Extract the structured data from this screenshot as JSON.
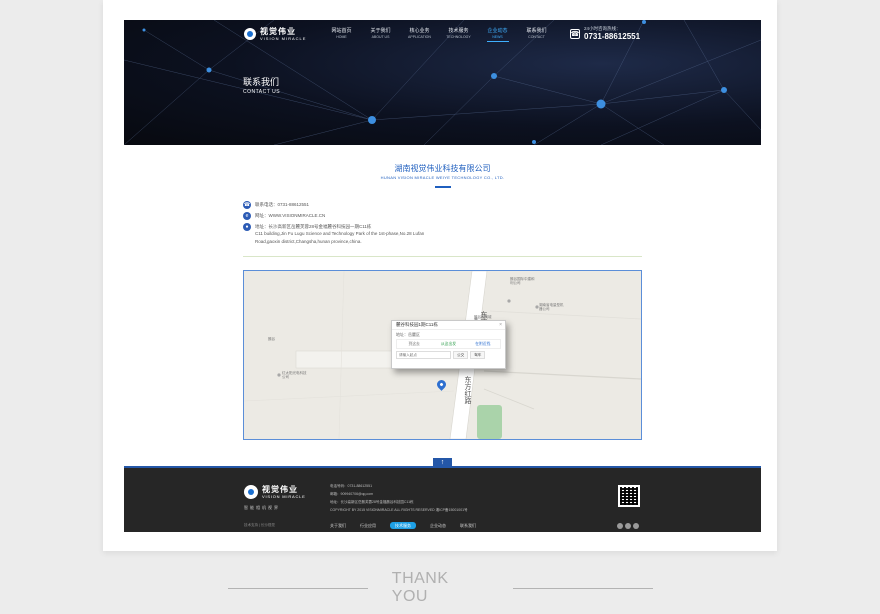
{
  "header": {
    "logo_cn": "视觉伟业",
    "logo_en": "VISION MIRACLE",
    "nav": [
      {
        "cn": "网站首页",
        "en": "HOME"
      },
      {
        "cn": "关于我们",
        "en": "ABOUT US"
      },
      {
        "cn": "核心业务",
        "en": "APPLICATION"
      },
      {
        "cn": "技术服务",
        "en": "TECHNOLOGY"
      },
      {
        "cn": "企业动态",
        "en": "NEWS"
      },
      {
        "cn": "联系我们",
        "en": "CONTACT"
      }
    ],
    "active_nav_index": 4,
    "hotline_label": "24小时咨询热线：",
    "hotline_number": "0731-88612551"
  },
  "hero": {
    "title_cn": "联系我们",
    "title_en": "CONTACT US"
  },
  "company": {
    "name_cn": "湖南视觉伟业科技有限公司",
    "name_en": "HUNAN VISION MIRACLE WEIYE TECHNOLOGY CO., LTD."
  },
  "contacts": {
    "phone": "联系电话：0731-88612551",
    "website": "网址：WWW.VISIONMIRACLE.CN",
    "address_cn": "地址：长沙高新区岳麓芙蓉28号金福麓谷科技园一期C11栋",
    "address_en_1": "C11 building,Jin Fu Lugu Science and Technology Park of the 1st-phase,No.28 Lufan",
    "address_en_2": "Road,gaoxin district,Changsha,hunan province,china."
  },
  "map": {
    "popup_title": "麓谷科技园1期C11栋",
    "popup_address": "地址：岳麓区",
    "tab_1": "到这去",
    "tab_2": "从这出发",
    "tab_3": "在附近找",
    "search_placeholder": "请输入起点",
    "btn_bus": "公交",
    "btn_drive": "驾车",
    "road_label": "东方红路",
    "place_1": "麓谷国际中建和利公司",
    "place_2": "湖南省电量型机器公司",
    "place_3": "麓谷家具城",
    "place_4": "红太阳光电科技公司",
    "place_5": "麓谷"
  },
  "back_top": {
    "label": "返回顶部"
  },
  "footer": {
    "logo_cn": "视觉伟业",
    "logo_en": "VISION MIRACLE",
    "slogan": "智能相机视界",
    "info_1": "电话号码：0731-88612551",
    "info_2": "邮箱：909940706@qq.com",
    "info_3": "地址：长沙高新区岳麓芙蓉28号金福麓谷科技园C11栋",
    "info_4": "COPYRIGHT BY 2015 VISIONMIRACLE ALL RIGHTS RESERVED 湘ICP备15001001号",
    "nav": [
      "关于我们",
      "行业应用",
      "技术服务",
      "企业动态",
      "联系我们"
    ],
    "active_index": 2,
    "tag": "技术支持 | 长沙视觉"
  },
  "thanks": "THANK YOU"
}
